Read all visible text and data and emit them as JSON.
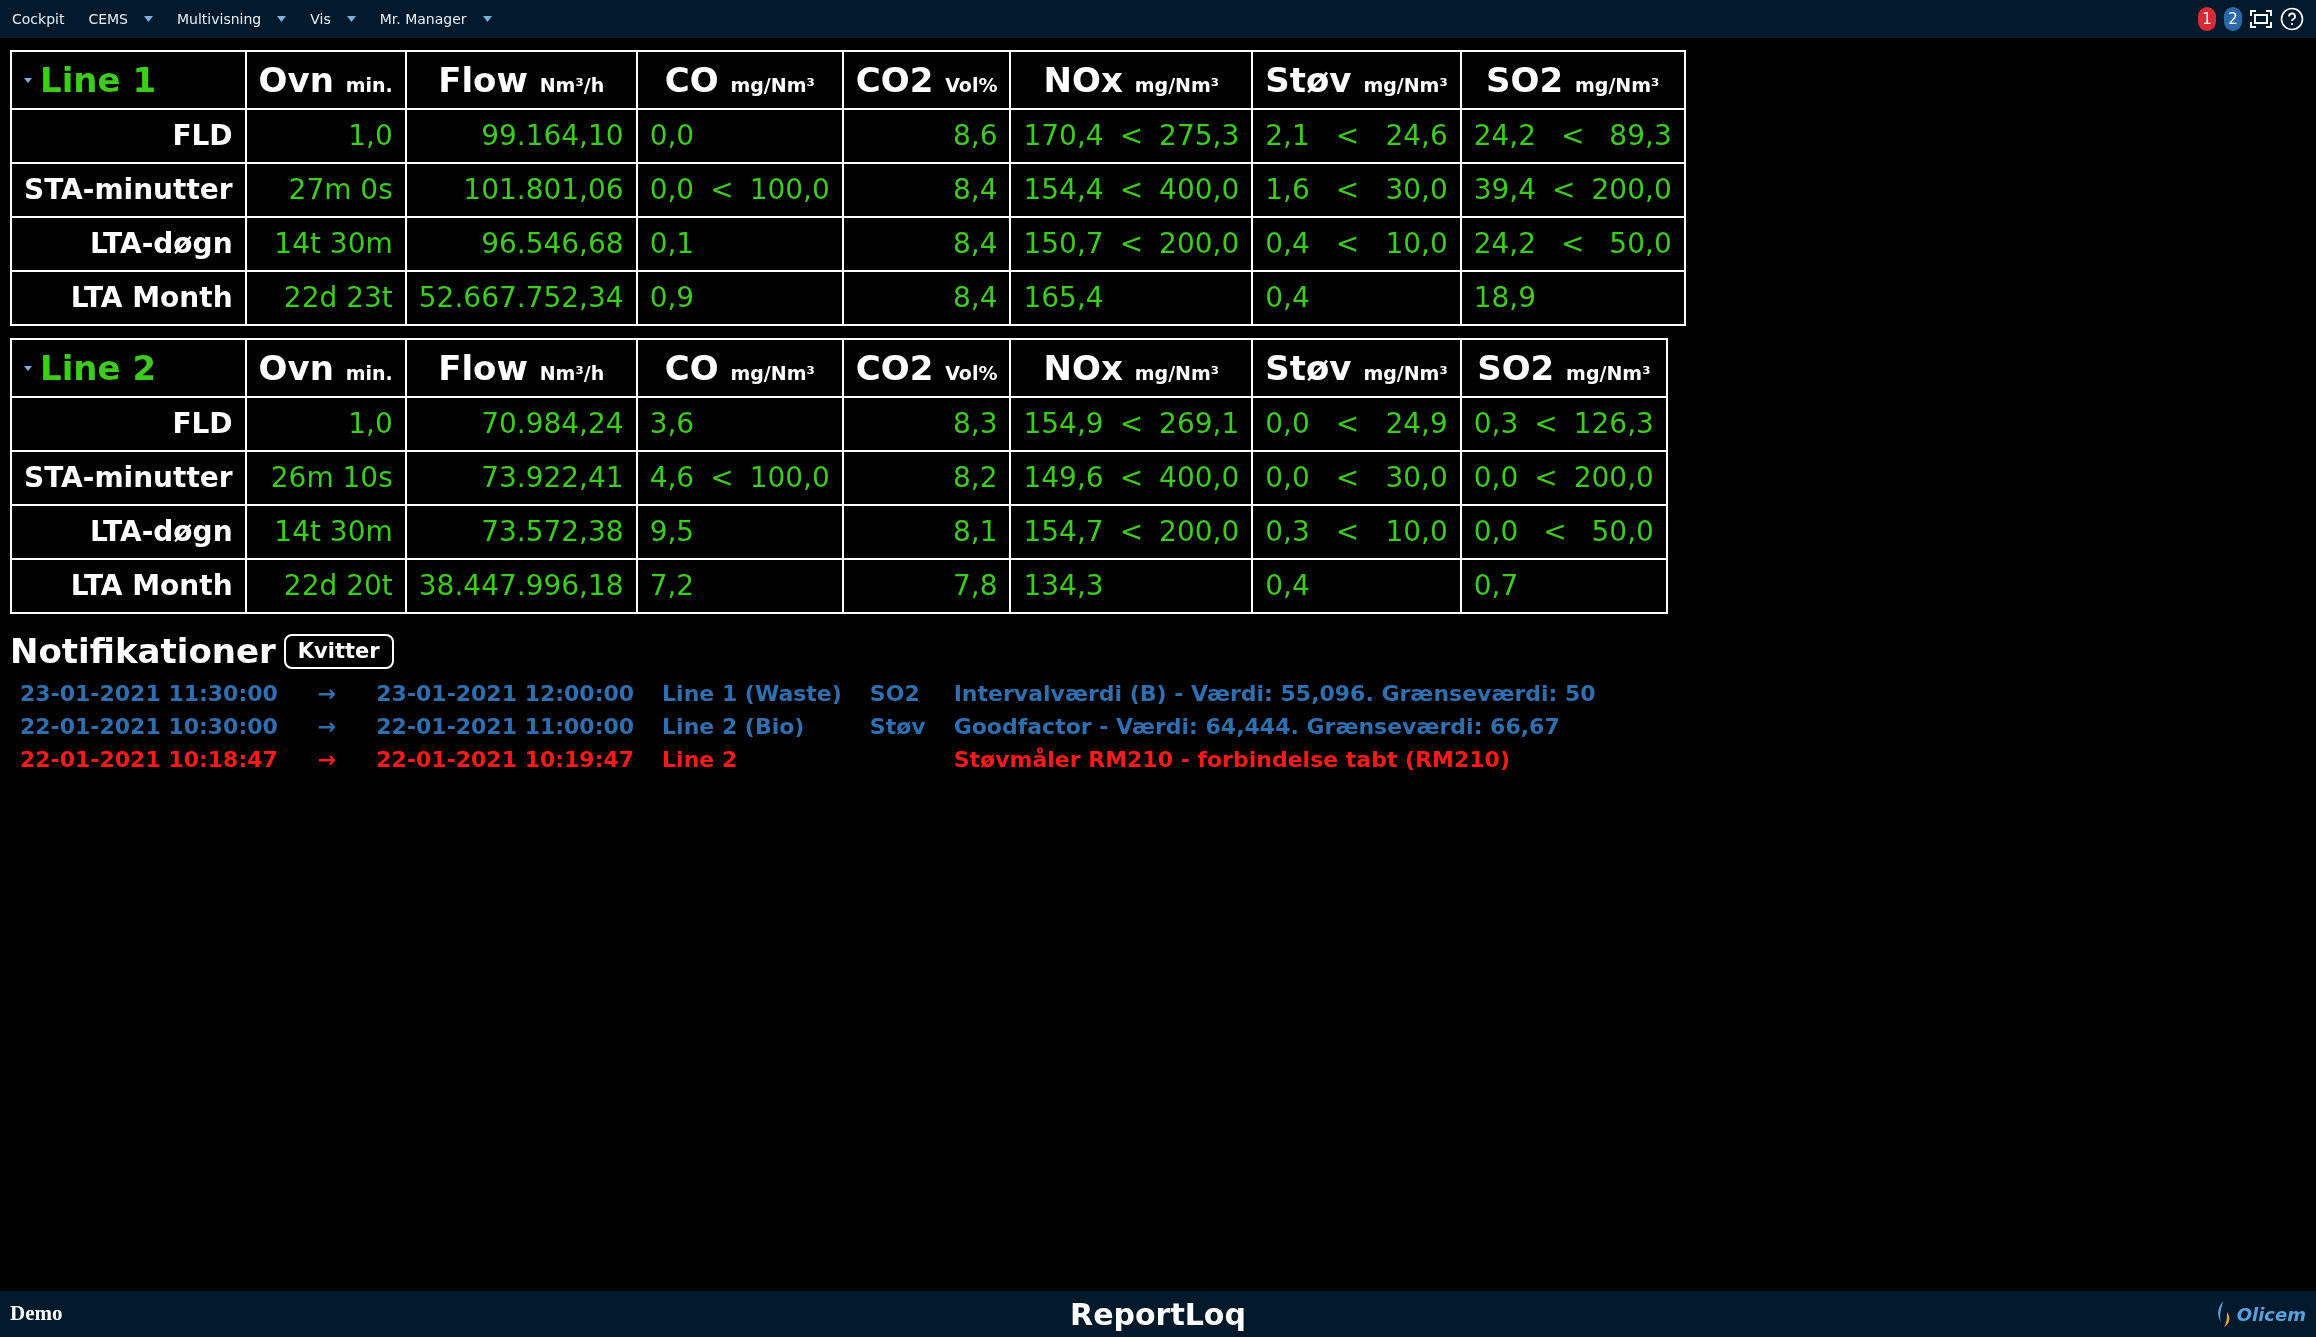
{
  "menu": [
    {
      "label": "Cockpit",
      "dropdown": false
    },
    {
      "label": "CEMS",
      "dropdown": true
    },
    {
      "label": "Multivisning",
      "dropdown": true
    },
    {
      "label": "Vis",
      "dropdown": true
    },
    {
      "label": "Mr. Manager",
      "dropdown": true
    }
  ],
  "badges": [
    {
      "count": "1",
      "color": "#dc2a34"
    },
    {
      "count": "2",
      "color": "#2a6aa8"
    }
  ],
  "tables": [
    {
      "title": "Line 1",
      "columns": [
        {
          "name": "Ovn",
          "unit": "min.",
          "kind": "plain"
        },
        {
          "name": "Flow",
          "unit": "Nm³/h",
          "kind": "plain"
        },
        {
          "name": "CO",
          "unit": "mg/Nm³",
          "kind": "limit"
        },
        {
          "name": "CO2",
          "unit": "Vol%",
          "kind": "plain"
        },
        {
          "name": "NOx",
          "unit": "mg/Nm³",
          "kind": "limit"
        },
        {
          "name": "Støv",
          "unit": "mg/Nm³",
          "kind": "limit"
        },
        {
          "name": "SO2",
          "unit": "mg/Nm³",
          "kind": "limit"
        }
      ],
      "rows": [
        {
          "label": "FLD",
          "cells": [
            {
              "value": "1,0"
            },
            {
              "value": "99.164,10"
            },
            {
              "value": "0,0"
            },
            {
              "value": "8,6"
            },
            {
              "value": "170,4",
              "limit": "275,3"
            },
            {
              "value": "2,1",
              "limit": "24,6"
            },
            {
              "value": "24,2",
              "limit": "89,3"
            }
          ]
        },
        {
          "label": "STA-minutter",
          "cells": [
            {
              "value": "27m 0s"
            },
            {
              "value": "101.801,06"
            },
            {
              "value": "0,0",
              "limit": "100,0"
            },
            {
              "value": "8,4"
            },
            {
              "value": "154,4",
              "limit": "400,0"
            },
            {
              "value": "1,6",
              "limit": "30,0"
            },
            {
              "value": "39,4",
              "limit": "200,0"
            }
          ]
        },
        {
          "label": "LTA-døgn",
          "cells": [
            {
              "value": "14t 30m"
            },
            {
              "value": "96.546,68"
            },
            {
              "value": "0,1"
            },
            {
              "value": "8,4"
            },
            {
              "value": "150,7",
              "limit": "200,0"
            },
            {
              "value": "0,4",
              "limit": "10,0"
            },
            {
              "value": "24,2",
              "limit": "50,0"
            }
          ]
        },
        {
          "label": "LTA Month",
          "cells": [
            {
              "value": "22d 23t"
            },
            {
              "value": "52.667.752,34"
            },
            {
              "value": "0,9"
            },
            {
              "value": "8,4"
            },
            {
              "value": "165,4"
            },
            {
              "value": "0,4"
            },
            {
              "value": "18,9"
            }
          ]
        }
      ]
    },
    {
      "title": "Line 2",
      "columns": [
        {
          "name": "Ovn",
          "unit": "min.",
          "kind": "plain"
        },
        {
          "name": "Flow",
          "unit": "Nm³/h",
          "kind": "plain"
        },
        {
          "name": "CO",
          "unit": "mg/Nm³",
          "kind": "limit"
        },
        {
          "name": "CO2",
          "unit": "Vol%",
          "kind": "plain"
        },
        {
          "name": "NOx",
          "unit": "mg/Nm³",
          "kind": "limit"
        },
        {
          "name": "Støv",
          "unit": "mg/Nm³",
          "kind": "limit"
        },
        {
          "name": "SO2",
          "unit": "mg/Nm³",
          "kind": "limit"
        }
      ],
      "rows": [
        {
          "label": "FLD",
          "cells": [
            {
              "value": "1,0"
            },
            {
              "value": "70.984,24"
            },
            {
              "value": "3,6"
            },
            {
              "value": "8,3"
            },
            {
              "value": "154,9",
              "limit": "269,1"
            },
            {
              "value": "0,0",
              "limit": "24,9"
            },
            {
              "value": "0,3",
              "limit": "126,3"
            }
          ]
        },
        {
          "label": "STA-minutter",
          "cells": [
            {
              "value": "26m 10s"
            },
            {
              "value": "73.922,41"
            },
            {
              "value": "4,6",
              "limit": "100,0"
            },
            {
              "value": "8,2"
            },
            {
              "value": "149,6",
              "limit": "400,0"
            },
            {
              "value": "0,0",
              "limit": "30,0"
            },
            {
              "value": "0,0",
              "limit": "200,0"
            }
          ]
        },
        {
          "label": "LTA-døgn",
          "cells": [
            {
              "value": "14t 30m"
            },
            {
              "value": "73.572,38"
            },
            {
              "value": "9,5"
            },
            {
              "value": "8,1"
            },
            {
              "value": "154,7",
              "limit": "200,0"
            },
            {
              "value": "0,3",
              "limit": "10,0"
            },
            {
              "value": "0,0",
              "limit": "50,0"
            }
          ]
        },
        {
          "label": "LTA Month",
          "cells": [
            {
              "value": "22d 20t"
            },
            {
              "value": "38.447.996,18"
            },
            {
              "value": "7,2"
            },
            {
              "value": "7,8"
            },
            {
              "value": "134,3"
            },
            {
              "value": "0,4"
            },
            {
              "value": "0,7"
            }
          ]
        }
      ]
    }
  ],
  "limit_sign": "<",
  "notifications": {
    "title": "Notifikationer",
    "button": "Kvitter",
    "items": [
      {
        "start": "23-01-2021 11:30:00",
        "arrow": "→",
        "end": "23-01-2021 12:00:00",
        "line": "Line 1 (Waste)",
        "component": "SO2",
        "message": "Intervalværdi (B) - Værdi: 55,096. Grænseværdi: 50",
        "color": "#2f6fb0"
      },
      {
        "start": "22-01-2021 10:30:00",
        "arrow": "→",
        "end": "22-01-2021 11:00:00",
        "line": "Line 2 (Bio)",
        "component": "Støv",
        "message": "Goodfactor - Værdi: 64,444. Grænseværdi: 66,67",
        "color": "#2f6fb0"
      },
      {
        "start": "22-01-2021 10:18:47",
        "arrow": "→",
        "end": "22-01-2021 10:19:47",
        "line": "Line 2",
        "message": "Støvmåler RM210 - forbindelse tabt (RM210)",
        "color": "#ff1a1a"
      }
    ]
  },
  "footer": {
    "left": "Demo",
    "center": "ReportLoq",
    "logo": "Olicem"
  }
}
